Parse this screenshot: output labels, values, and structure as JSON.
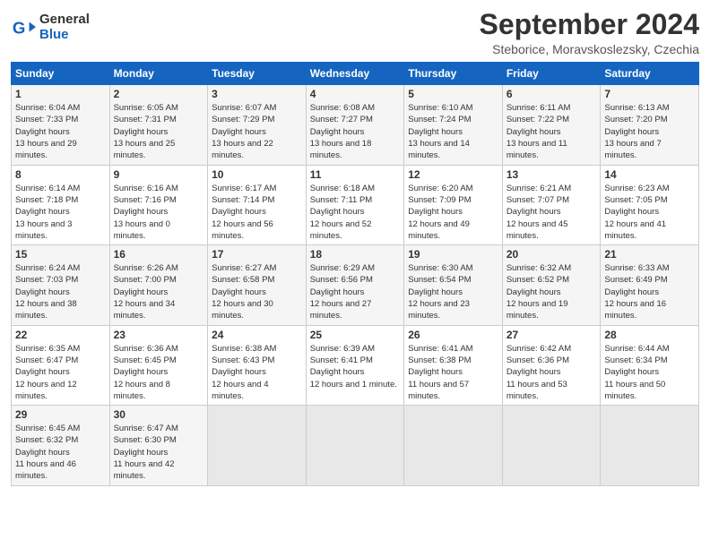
{
  "header": {
    "logo_line1": "General",
    "logo_line2": "Blue",
    "month_title": "September 2024",
    "subtitle": "Steborice, Moravskoslezsky, Czechia"
  },
  "weekdays": [
    "Sunday",
    "Monday",
    "Tuesday",
    "Wednesday",
    "Thursday",
    "Friday",
    "Saturday"
  ],
  "weeks": [
    [
      {
        "day": "1",
        "sunrise": "6:04 AM",
        "sunset": "7:33 PM",
        "daylight": "13 hours and 29 minutes."
      },
      {
        "day": "2",
        "sunrise": "6:05 AM",
        "sunset": "7:31 PM",
        "daylight": "13 hours and 25 minutes."
      },
      {
        "day": "3",
        "sunrise": "6:07 AM",
        "sunset": "7:29 PM",
        "daylight": "13 hours and 22 minutes."
      },
      {
        "day": "4",
        "sunrise": "6:08 AM",
        "sunset": "7:27 PM",
        "daylight": "13 hours and 18 minutes."
      },
      {
        "day": "5",
        "sunrise": "6:10 AM",
        "sunset": "7:24 PM",
        "daylight": "13 hours and 14 minutes."
      },
      {
        "day": "6",
        "sunrise": "6:11 AM",
        "sunset": "7:22 PM",
        "daylight": "13 hours and 11 minutes."
      },
      {
        "day": "7",
        "sunrise": "6:13 AM",
        "sunset": "7:20 PM",
        "daylight": "13 hours and 7 minutes."
      }
    ],
    [
      {
        "day": "8",
        "sunrise": "6:14 AM",
        "sunset": "7:18 PM",
        "daylight": "13 hours and 3 minutes."
      },
      {
        "day": "9",
        "sunrise": "6:16 AM",
        "sunset": "7:16 PM",
        "daylight": "13 hours and 0 minutes."
      },
      {
        "day": "10",
        "sunrise": "6:17 AM",
        "sunset": "7:14 PM",
        "daylight": "12 hours and 56 minutes."
      },
      {
        "day": "11",
        "sunrise": "6:18 AM",
        "sunset": "7:11 PM",
        "daylight": "12 hours and 52 minutes."
      },
      {
        "day": "12",
        "sunrise": "6:20 AM",
        "sunset": "7:09 PM",
        "daylight": "12 hours and 49 minutes."
      },
      {
        "day": "13",
        "sunrise": "6:21 AM",
        "sunset": "7:07 PM",
        "daylight": "12 hours and 45 minutes."
      },
      {
        "day": "14",
        "sunrise": "6:23 AM",
        "sunset": "7:05 PM",
        "daylight": "12 hours and 41 minutes."
      }
    ],
    [
      {
        "day": "15",
        "sunrise": "6:24 AM",
        "sunset": "7:03 PM",
        "daylight": "12 hours and 38 minutes."
      },
      {
        "day": "16",
        "sunrise": "6:26 AM",
        "sunset": "7:00 PM",
        "daylight": "12 hours and 34 minutes."
      },
      {
        "day": "17",
        "sunrise": "6:27 AM",
        "sunset": "6:58 PM",
        "daylight": "12 hours and 30 minutes."
      },
      {
        "day": "18",
        "sunrise": "6:29 AM",
        "sunset": "6:56 PM",
        "daylight": "12 hours and 27 minutes."
      },
      {
        "day": "19",
        "sunrise": "6:30 AM",
        "sunset": "6:54 PM",
        "daylight": "12 hours and 23 minutes."
      },
      {
        "day": "20",
        "sunrise": "6:32 AM",
        "sunset": "6:52 PM",
        "daylight": "12 hours and 19 minutes."
      },
      {
        "day": "21",
        "sunrise": "6:33 AM",
        "sunset": "6:49 PM",
        "daylight": "12 hours and 16 minutes."
      }
    ],
    [
      {
        "day": "22",
        "sunrise": "6:35 AM",
        "sunset": "6:47 PM",
        "daylight": "12 hours and 12 minutes."
      },
      {
        "day": "23",
        "sunrise": "6:36 AM",
        "sunset": "6:45 PM",
        "daylight": "12 hours and 8 minutes."
      },
      {
        "day": "24",
        "sunrise": "6:38 AM",
        "sunset": "6:43 PM",
        "daylight": "12 hours and 4 minutes."
      },
      {
        "day": "25",
        "sunrise": "6:39 AM",
        "sunset": "6:41 PM",
        "daylight": "12 hours and 1 minute."
      },
      {
        "day": "26",
        "sunrise": "6:41 AM",
        "sunset": "6:38 PM",
        "daylight": "11 hours and 57 minutes."
      },
      {
        "day": "27",
        "sunrise": "6:42 AM",
        "sunset": "6:36 PM",
        "daylight": "11 hours and 53 minutes."
      },
      {
        "day": "28",
        "sunrise": "6:44 AM",
        "sunset": "6:34 PM",
        "daylight": "11 hours and 50 minutes."
      }
    ],
    [
      {
        "day": "29",
        "sunrise": "6:45 AM",
        "sunset": "6:32 PM",
        "daylight": "11 hours and 46 minutes."
      },
      {
        "day": "30",
        "sunrise": "6:47 AM",
        "sunset": "6:30 PM",
        "daylight": "11 hours and 42 minutes."
      },
      null,
      null,
      null,
      null,
      null
    ]
  ]
}
